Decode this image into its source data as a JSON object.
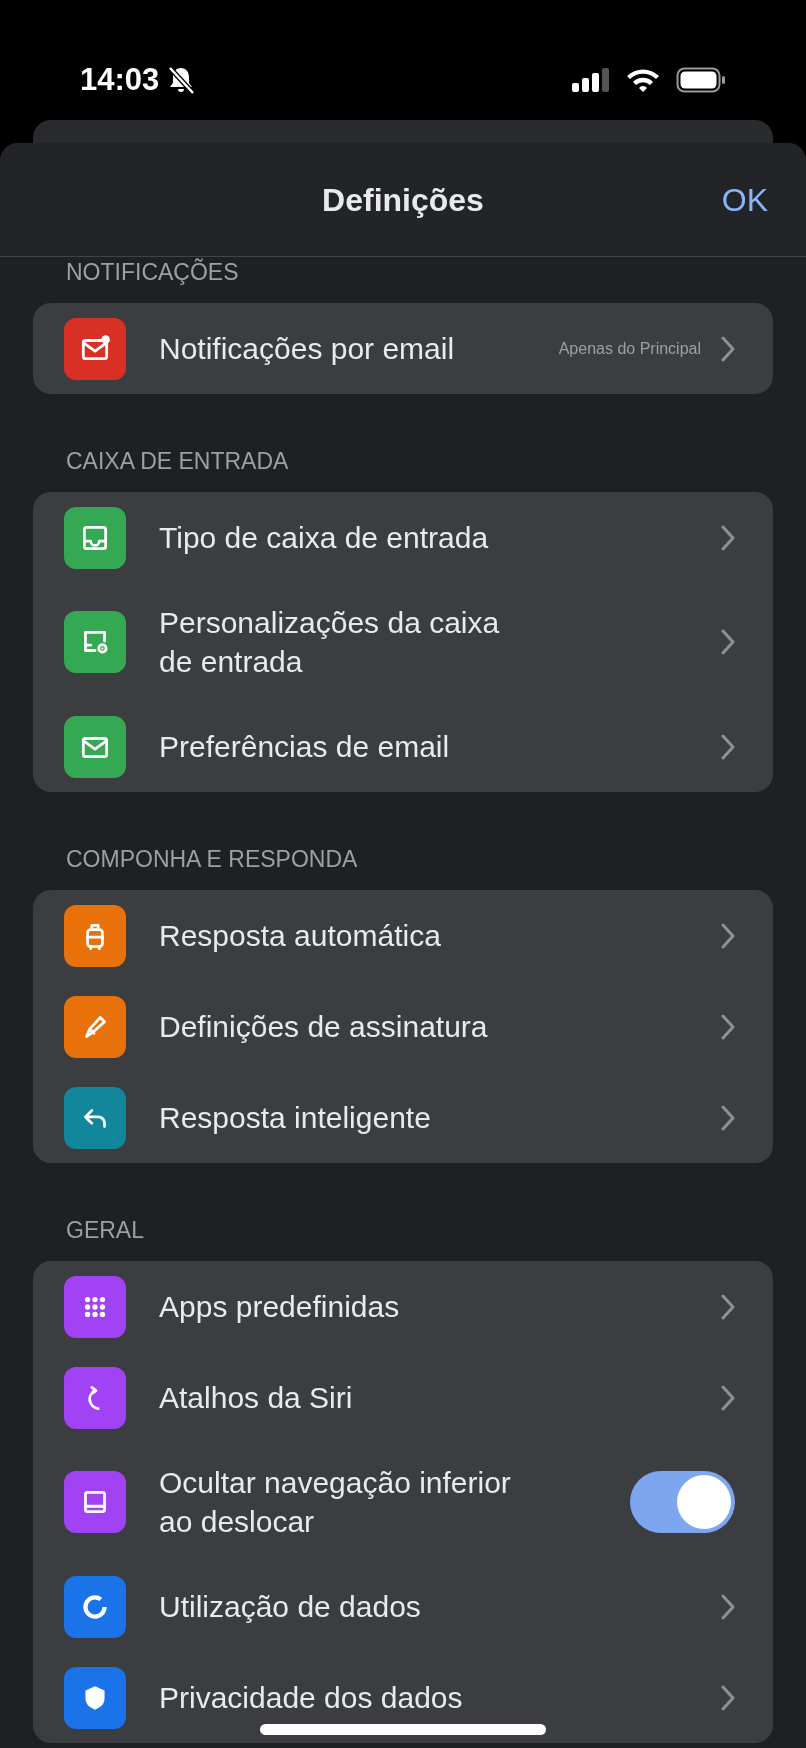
{
  "status_bar": {
    "time": "14:03"
  },
  "header": {
    "title": "Definições",
    "done_button": "OK"
  },
  "sections": [
    {
      "label": "NOTIFICAÇÕES",
      "items": [
        {
          "kind": "link",
          "label": "Notificações por email",
          "value": "Apenas do Principal",
          "color": "#d93025"
        }
      ]
    },
    {
      "label": "CAIXA DE ENTRADA",
      "items": [
        {
          "kind": "link",
          "label": "Tipo de caixa de entrada",
          "color": "#34a853"
        },
        {
          "kind": "link",
          "label": "Personalizações da caixa de entrada",
          "color": "#34a853"
        },
        {
          "kind": "link",
          "label": "Preferências de email",
          "color": "#34a853"
        }
      ]
    },
    {
      "label": "COMPONHA E RESPONDA",
      "items": [
        {
          "kind": "link",
          "label": "Resposta automática",
          "color": "#e8710a"
        },
        {
          "kind": "link",
          "label": "Definições de assinatura",
          "color": "#e8710a"
        },
        {
          "kind": "link",
          "label": "Resposta inteligente",
          "color": "#12869b"
        }
      ]
    },
    {
      "label": "GERAL",
      "items": [
        {
          "kind": "link",
          "label": "Apps predefinidas",
          "color": "#a142f4"
        },
        {
          "kind": "link",
          "label": "Atalhos da Siri",
          "color": "#a142f4"
        },
        {
          "kind": "toggle",
          "label": "Ocultar navegação inferior ao deslocar",
          "on": true,
          "color": "#a142f4"
        },
        {
          "kind": "link",
          "label": "Utilização de dados",
          "color": "#1a73e8"
        },
        {
          "kind": "link",
          "label": "Privacidade dos dados",
          "color": "#1a73e8"
        }
      ]
    }
  ]
}
